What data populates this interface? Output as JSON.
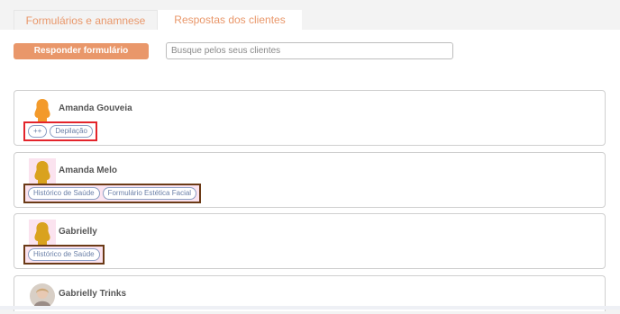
{
  "tabs": [
    {
      "label": "Formulários e anamnese",
      "active": false
    },
    {
      "label": "Respostas dos clientes",
      "active": true
    }
  ],
  "toolbar": {
    "respond_label": "Responder formulário",
    "search_placeholder": "Busque pelos seus clientes",
    "search_value": ""
  },
  "clients": [
    {
      "name": "Amanda Gouveia",
      "avatar": "person-silhouette-orange-icon",
      "tags": [
        "++",
        "Depilação"
      ]
    },
    {
      "name": "Amanda Melo",
      "avatar": "person-silhouette-gold-icon",
      "tags": [
        "Histórico de Saúde",
        "Formulário Estética Facial"
      ]
    },
    {
      "name": "Gabrielly",
      "avatar": "person-silhouette-gold-icon",
      "tags": [
        "Histórico de Saúde"
      ]
    },
    {
      "name": "Gabrielly Trinks",
      "avatar": "profile-photo",
      "tags": []
    }
  ],
  "colors": {
    "accent": "#e9976a",
    "tag_text": "#6b80a8",
    "highlight_red": "#e3242b",
    "highlight_brown": "#6b3a16"
  }
}
